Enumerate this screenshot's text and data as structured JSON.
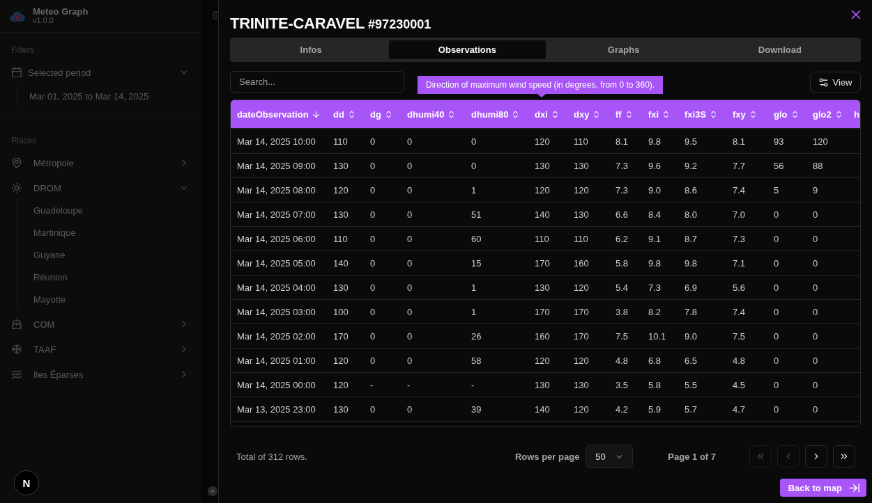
{
  "sidebar": {
    "app_name": "Meteo Graph",
    "version": "v1.0.0",
    "sections": [
      {
        "title": "Filters",
        "items": [
          {
            "label": "Selected period",
            "expanded": true,
            "children": [
              {
                "label": "Mar 01, 2025 to Mar 14, 2025"
              }
            ]
          }
        ]
      },
      {
        "title": "Places",
        "items": [
          {
            "label": "Métropole",
            "expanded": false
          },
          {
            "label": "DROM",
            "expanded": true,
            "children": [
              {
                "label": "Guadeloupe"
              },
              {
                "label": "Martinique"
              },
              {
                "label": "Guyane"
              },
              {
                "label": "Réunion"
              },
              {
                "label": "Mayotte"
              }
            ]
          },
          {
            "label": "COM",
            "expanded": false
          },
          {
            "label": "TAAF",
            "expanded": false
          },
          {
            "label": "Iles Éparses",
            "expanded": false
          }
        ]
      }
    ]
  },
  "dev_badge": {
    "label": "N"
  },
  "station": {
    "name": "TRINITE-CARAVEL",
    "id": "#97230001"
  },
  "tabs": [
    {
      "label": "Infos",
      "selected": false
    },
    {
      "label": "Observations",
      "selected": true
    },
    {
      "label": "Graphs",
      "selected": false
    },
    {
      "label": "Download",
      "selected": false
    }
  ],
  "search": {
    "placeholder": "Search..."
  },
  "tooltip": {
    "text": "Direction of maximum wind speed (in degrees, from 0 to 360)."
  },
  "view_button": {
    "label": "View"
  },
  "table": {
    "columns": [
      {
        "label": "dateObservation",
        "sorted": true
      },
      {
        "label": "dd",
        "sorted": false
      },
      {
        "label": "dg",
        "sorted": false
      },
      {
        "label": "dhumi40",
        "sorted": false
      },
      {
        "label": "dhumi80",
        "sorted": false
      },
      {
        "label": "dxi",
        "sorted": false
      },
      {
        "label": "dxy",
        "sorted": false
      },
      {
        "label": "ff",
        "sorted": false
      },
      {
        "label": "fxi",
        "sorted": false
      },
      {
        "label": "fxi3S",
        "sorted": false
      },
      {
        "label": "fxy",
        "sorted": false
      },
      {
        "label": "glo",
        "sorted": false
      },
      {
        "label": "glo2",
        "sorted": false
      },
      {
        "label": "h"
      }
    ],
    "rows": [
      [
        "Mar 14, 2025 10:00",
        "110",
        "0",
        "0",
        "0",
        "120",
        "110",
        "8.1",
        "9.8",
        "9.5",
        "8.1",
        "93",
        "120"
      ],
      [
        "Mar 14, 2025 09:00",
        "130",
        "0",
        "0",
        "0",
        "130",
        "130",
        "7.3",
        "9.6",
        "9.2",
        "7.7",
        "56",
        "88"
      ],
      [
        "Mar 14, 2025 08:00",
        "120",
        "0",
        "0",
        "1",
        "120",
        "120",
        "7.3",
        "9.0",
        "8.6",
        "7.4",
        "5",
        "9"
      ],
      [
        "Mar 14, 2025 07:00",
        "130",
        "0",
        "0",
        "51",
        "140",
        "130",
        "6.6",
        "8.4",
        "8.0",
        "7.0",
        "0",
        "0"
      ],
      [
        "Mar 14, 2025 06:00",
        "110",
        "0",
        "0",
        "60",
        "110",
        "110",
        "6.2",
        "9.1",
        "8.7",
        "7.3",
        "0",
        "0"
      ],
      [
        "Mar 14, 2025 05:00",
        "140",
        "0",
        "0",
        "15",
        "170",
        "160",
        "5.8",
        "9.8",
        "9.8",
        "7.1",
        "0",
        "0"
      ],
      [
        "Mar 14, 2025 04:00",
        "130",
        "0",
        "0",
        "1",
        "130",
        "120",
        "5.4",
        "7.3",
        "6.9",
        "5.6",
        "0",
        "0"
      ],
      [
        "Mar 14, 2025 03:00",
        "100",
        "0",
        "0",
        "1",
        "170",
        "170",
        "3.8",
        "8.2",
        "7.8",
        "7.4",
        "0",
        "0"
      ],
      [
        "Mar 14, 2025 02:00",
        "170",
        "0",
        "0",
        "26",
        "160",
        "170",
        "7.5",
        "10.1",
        "9.0",
        "7.5",
        "0",
        "0"
      ],
      [
        "Mar 14, 2025 01:00",
        "120",
        "0",
        "0",
        "58",
        "120",
        "120",
        "4.8",
        "6.8",
        "6.5",
        "4.8",
        "0",
        "0"
      ],
      [
        "Mar 14, 2025 00:00",
        "120",
        "-",
        "-",
        "-",
        "130",
        "130",
        "3.5",
        "5.8",
        "5.5",
        "4.5",
        "0",
        "0"
      ],
      [
        "Mar 13, 2025 23:00",
        "130",
        "0",
        "0",
        "39",
        "140",
        "120",
        "4.2",
        "5.9",
        "5.7",
        "4.7",
        "0",
        "0"
      ]
    ]
  },
  "footer": {
    "total": "Total of 312 rows.",
    "rows_per_page": {
      "label": "Rows per page",
      "value": "50"
    },
    "page": "Page 1 of 7",
    "pager": [
      {
        "kind": "first",
        "disabled": true
      },
      {
        "kind": "prev",
        "disabled": true
      },
      {
        "kind": "next",
        "disabled": false
      },
      {
        "kind": "last",
        "disabled": false
      }
    ]
  },
  "back_button": {
    "label": "Back to map"
  }
}
